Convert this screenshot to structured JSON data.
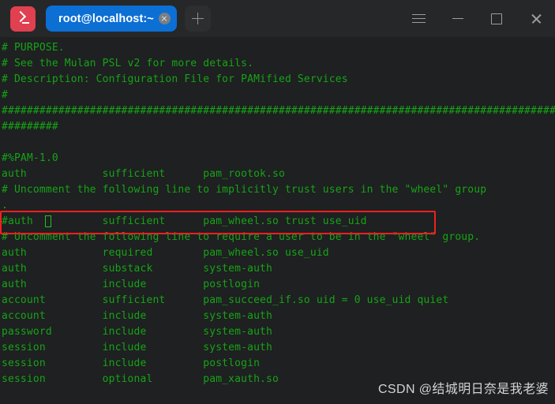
{
  "window": {
    "app_icon": "terminal-prompt-icon",
    "tabs": [
      {
        "label": "root@localhost:~",
        "active": true,
        "close_icon": "close-icon"
      }
    ],
    "new_tab_label": "+",
    "controls": [
      {
        "name": "menu-button",
        "icon": "hamburger-icon"
      },
      {
        "name": "minimize-button",
        "icon": "minimize-icon"
      },
      {
        "name": "maximize-button",
        "icon": "maximize-icon"
      },
      {
        "name": "close-button",
        "icon": "close-icon"
      }
    ]
  },
  "terminal": {
    "colors": {
      "background": "#1e2021",
      "foreground": "#17a317",
      "cursor": "#1ec41e",
      "titlebar": "#262728",
      "tab_active": "#0b6fd4",
      "app_icon": "#e0404f",
      "annotation": "#f41f1f"
    },
    "lines": [
      {
        "text": "# PURPOSE."
      },
      {
        "text": "# See the Mulan PSL v2 for more details."
      },
      {
        "text": "# Description: Configuration File for PAMified Services"
      },
      {
        "text": "#"
      },
      {
        "text": "########################################################################################"
      },
      {
        "text": "#########"
      },
      {
        "text": ""
      },
      {
        "text": "#%PAM-1.0"
      },
      {
        "text": "auth            sufficient      pam_rootok.so"
      },
      {
        "text": "# Uncomment the following line to implicitly trust users in the \"wheel\" group"
      },
      {
        "text": "."
      },
      {
        "text": "#auth           sufficient      pam_wheel.so trust use_uid"
      },
      {
        "text": "# Uncomment the following line to require a user to be in the \"wheel\" group."
      },
      {
        "text": "auth            required        pam_wheel.so use_uid"
      },
      {
        "text": "auth            substack        system-auth"
      },
      {
        "text": "auth            include         postlogin"
      },
      {
        "text": "account         sufficient      pam_succeed_if.so uid = 0 use_uid quiet"
      },
      {
        "text": "account         include         system-auth"
      },
      {
        "text": "password        include         system-auth"
      },
      {
        "text": "session         include         system-auth"
      },
      {
        "text": "session         include         postlogin"
      },
      {
        "text": "session         optional        pam_xauth.so"
      }
    ],
    "cursor": {
      "line_index": 11,
      "column": 7
    },
    "annotation": {
      "label": "highlight-box",
      "line_index": 11
    }
  },
  "watermark": {
    "text": "CSDN @结城明日奈是我老婆"
  }
}
